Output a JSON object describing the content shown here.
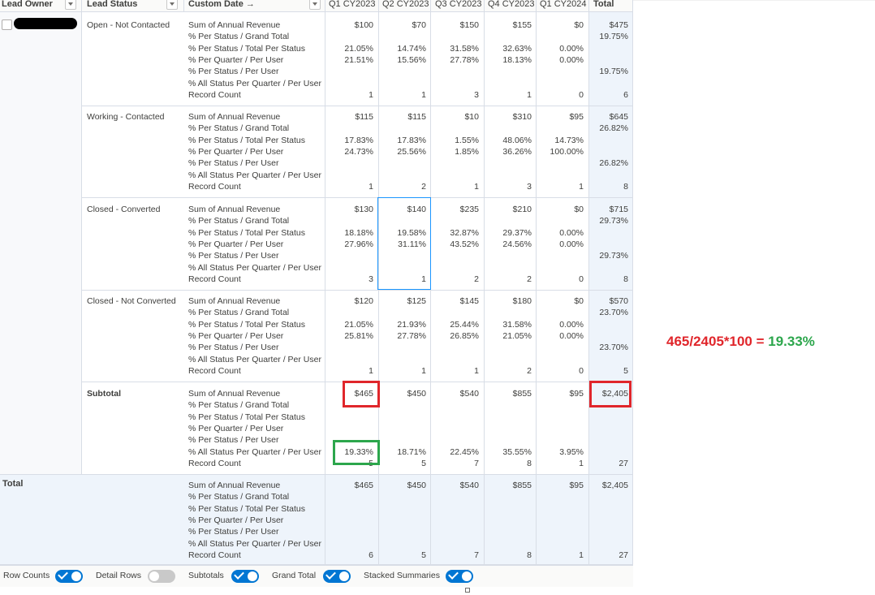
{
  "header": {
    "lead_owner": "Lead Owner",
    "lead_status": "Lead Status",
    "custom_date": "Custom Date →",
    "quarters": [
      "Q1 CY2023",
      "Q2 CY2023",
      "Q3 CY2023",
      "Q4 CY2023",
      "Q1 CY2024"
    ],
    "total": "Total"
  },
  "measures": [
    "Sum of Annual Revenue",
    "% Per Status / Grand Total",
    "% Per Status / Total Per Status",
    "% Per Quarter / Per User",
    "% Per Status / Per User",
    "% All Status Per Quarter / Per User",
    "Record Count"
  ],
  "groups": [
    {
      "status": "Open - Not Contacted",
      "cols": [
        [
          "$100",
          "",
          "21.05%",
          "21.51%",
          "",
          "",
          "1"
        ],
        [
          "$70",
          "",
          "14.74%",
          "15.56%",
          "",
          "",
          "1"
        ],
        [
          "$150",
          "",
          "31.58%",
          "27.78%",
          "",
          "",
          "3"
        ],
        [
          "$155",
          "",
          "32.63%",
          "18.13%",
          "",
          "",
          "1"
        ],
        [
          "$0",
          "",
          "0.00%",
          "0.00%",
          "",
          "",
          "0"
        ],
        [
          "$475",
          "19.75%",
          "",
          "",
          "19.75%",
          "",
          "6"
        ]
      ]
    },
    {
      "status": "Working - Contacted",
      "cols": [
        [
          "$115",
          "",
          "17.83%",
          "24.73%",
          "",
          "",
          "1"
        ],
        [
          "$115",
          "",
          "17.83%",
          "25.56%",
          "",
          "",
          "2"
        ],
        [
          "$10",
          "",
          "1.55%",
          "1.85%",
          "",
          "",
          "1"
        ],
        [
          "$310",
          "",
          "48.06%",
          "36.26%",
          "",
          "",
          "3"
        ],
        [
          "$95",
          "",
          "14.73%",
          "100.00%",
          "",
          "",
          "1"
        ],
        [
          "$645",
          "26.82%",
          "",
          "",
          "26.82%",
          "",
          "8"
        ]
      ]
    },
    {
      "status": "Closed - Converted",
      "cols": [
        [
          "$130",
          "",
          "18.18%",
          "27.96%",
          "",
          "",
          "3"
        ],
        [
          "$140",
          "",
          "19.58%",
          "31.11%",
          "",
          "",
          "1"
        ],
        [
          "$235",
          "",
          "32.87%",
          "43.52%",
          "",
          "",
          "2"
        ],
        [
          "$210",
          "",
          "29.37%",
          "24.56%",
          "",
          "",
          "2"
        ],
        [
          "$0",
          "",
          "0.00%",
          "0.00%",
          "",
          "",
          "0"
        ],
        [
          "$715",
          "29.73%",
          "",
          "",
          "29.73%",
          "",
          "8"
        ]
      ]
    },
    {
      "status": "Closed - Not Converted",
      "cols": [
        [
          "$120",
          "",
          "21.05%",
          "25.81%",
          "",
          "",
          "1"
        ],
        [
          "$125",
          "",
          "21.93%",
          "27.78%",
          "",
          "",
          "1"
        ],
        [
          "$145",
          "",
          "25.44%",
          "26.85%",
          "",
          "",
          "1"
        ],
        [
          "$180",
          "",
          "31.58%",
          "21.05%",
          "",
          "",
          "2"
        ],
        [
          "$0",
          "",
          "0.00%",
          "0.00%",
          "",
          "",
          "0"
        ],
        [
          "$570",
          "23.70%",
          "",
          "",
          "23.70%",
          "",
          "5"
        ]
      ]
    },
    {
      "status": "Subtotal",
      "cols": [
        [
          "$465",
          "",
          "",
          "",
          "",
          "19.33%",
          "5"
        ],
        [
          "$450",
          "",
          "",
          "",
          "",
          "18.71%",
          "5"
        ],
        [
          "$540",
          "",
          "",
          "",
          "",
          "22.45%",
          "7"
        ],
        [
          "$855",
          "",
          "",
          "",
          "",
          "35.55%",
          "8"
        ],
        [
          "$95",
          "",
          "",
          "",
          "",
          "3.95%",
          "1"
        ],
        [
          "$2,405",
          "",
          "",
          "",
          "",
          "",
          "27"
        ]
      ]
    },
    {
      "status": "",
      "cols": [
        [
          "$465",
          "",
          "",
          "",
          "",
          "",
          "6"
        ],
        [
          "$450",
          "",
          "",
          "",
          "",
          "",
          "5"
        ],
        [
          "$540",
          "",
          "",
          "",
          "",
          "",
          "7"
        ],
        [
          "$855",
          "",
          "",
          "",
          "",
          "",
          "8"
        ],
        [
          "$95",
          "",
          "",
          "",
          "",
          "",
          "1"
        ],
        [
          "$2,405",
          "",
          "",
          "",
          "",
          "",
          "27"
        ]
      ]
    }
  ],
  "total_label": "Total",
  "annotation": {
    "formula": "465/2405*100 = ",
    "result": "19.33%",
    "formula_color": "#e0262b",
    "result_color": "#2ca64c"
  },
  "footer": {
    "row_counts": {
      "label": "Row Counts",
      "on": true
    },
    "detail_rows": {
      "label": "Detail Rows",
      "on": false
    },
    "subtotals": {
      "label": "Subtotals",
      "on": true
    },
    "grand_total": {
      "label": "Grand Total",
      "on": true
    },
    "stacked_summaries": {
      "label": "Stacked Summaries",
      "on": true
    }
  },
  "colors": {
    "accent": "#0176d3",
    "border": "#d8dde6",
    "total_bg": "#eef4fb",
    "grand_total_bg": "#eef4fb"
  }
}
